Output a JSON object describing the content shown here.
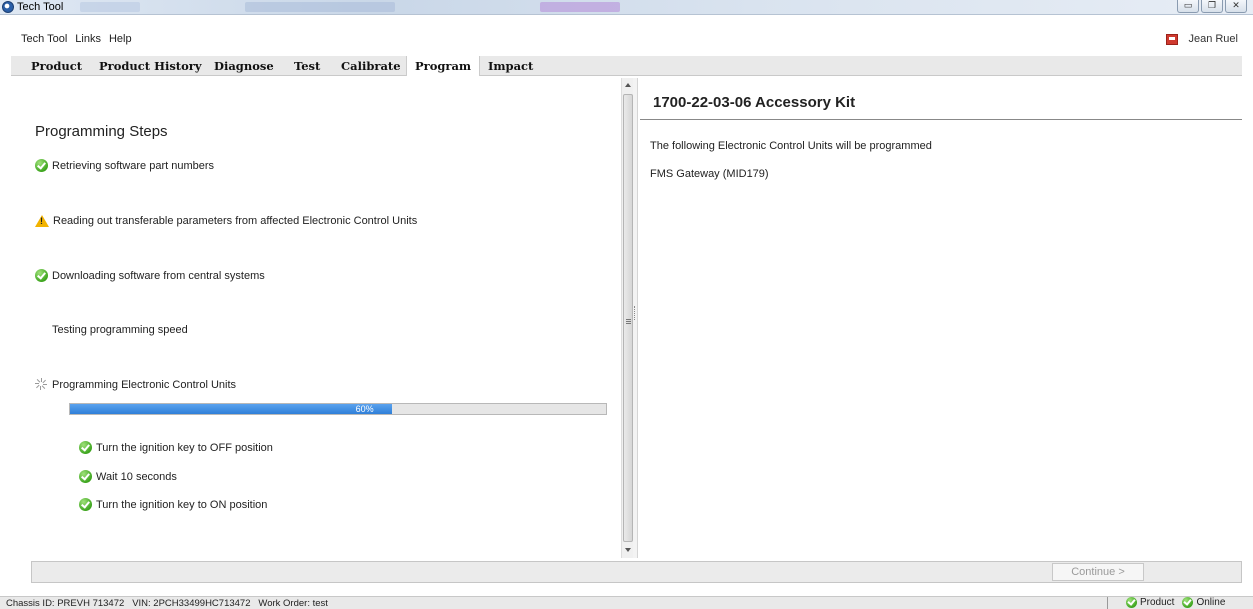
{
  "window": {
    "title": "Tech Tool"
  },
  "menu": {
    "items": [
      "Tech Tool",
      "Links",
      "Help"
    ],
    "user": "Jean Ruel"
  },
  "tabs": [
    "Product",
    "Product History",
    "Diagnose",
    "Test",
    "Calibrate",
    "Program",
    "Impact"
  ],
  "active_tab": "Program",
  "programming": {
    "title": "Programming Steps",
    "steps": [
      {
        "label": "Retrieving software part numbers",
        "status": "done"
      },
      {
        "label": "Reading out transferable parameters from affected Electronic Control Units",
        "status": "warning"
      },
      {
        "label": "Downloading software from central systems",
        "status": "done"
      },
      {
        "label": "Testing programming speed",
        "status": "none"
      },
      {
        "label": "Programming Electronic Control Units",
        "status": "in-progress"
      }
    ],
    "progress": {
      "percent": 60,
      "label": "60%"
    },
    "substeps": [
      {
        "label": "Turn the ignition key to OFF position",
        "status": "done"
      },
      {
        "label": "Wait 10 seconds",
        "status": "done"
      },
      {
        "label": "Turn the ignition key to ON position",
        "status": "done"
      }
    ]
  },
  "kit": {
    "title": "1700-22-03-06 Accessory Kit",
    "intro": "The following Electronic Control Units will be programmed",
    "units": [
      "FMS Gateway (MID179)"
    ]
  },
  "footer": {
    "continue_label": "Continue >"
  },
  "status": {
    "info": "Chassis ID: PREVH 713472   VIN: 2PCH33499HC713472   Work Order: test",
    "indicators": [
      "Product",
      "Online"
    ]
  },
  "colors": {
    "progress": "#3a8ae0",
    "check": "#3ea51f",
    "warning": "#f2b300"
  }
}
